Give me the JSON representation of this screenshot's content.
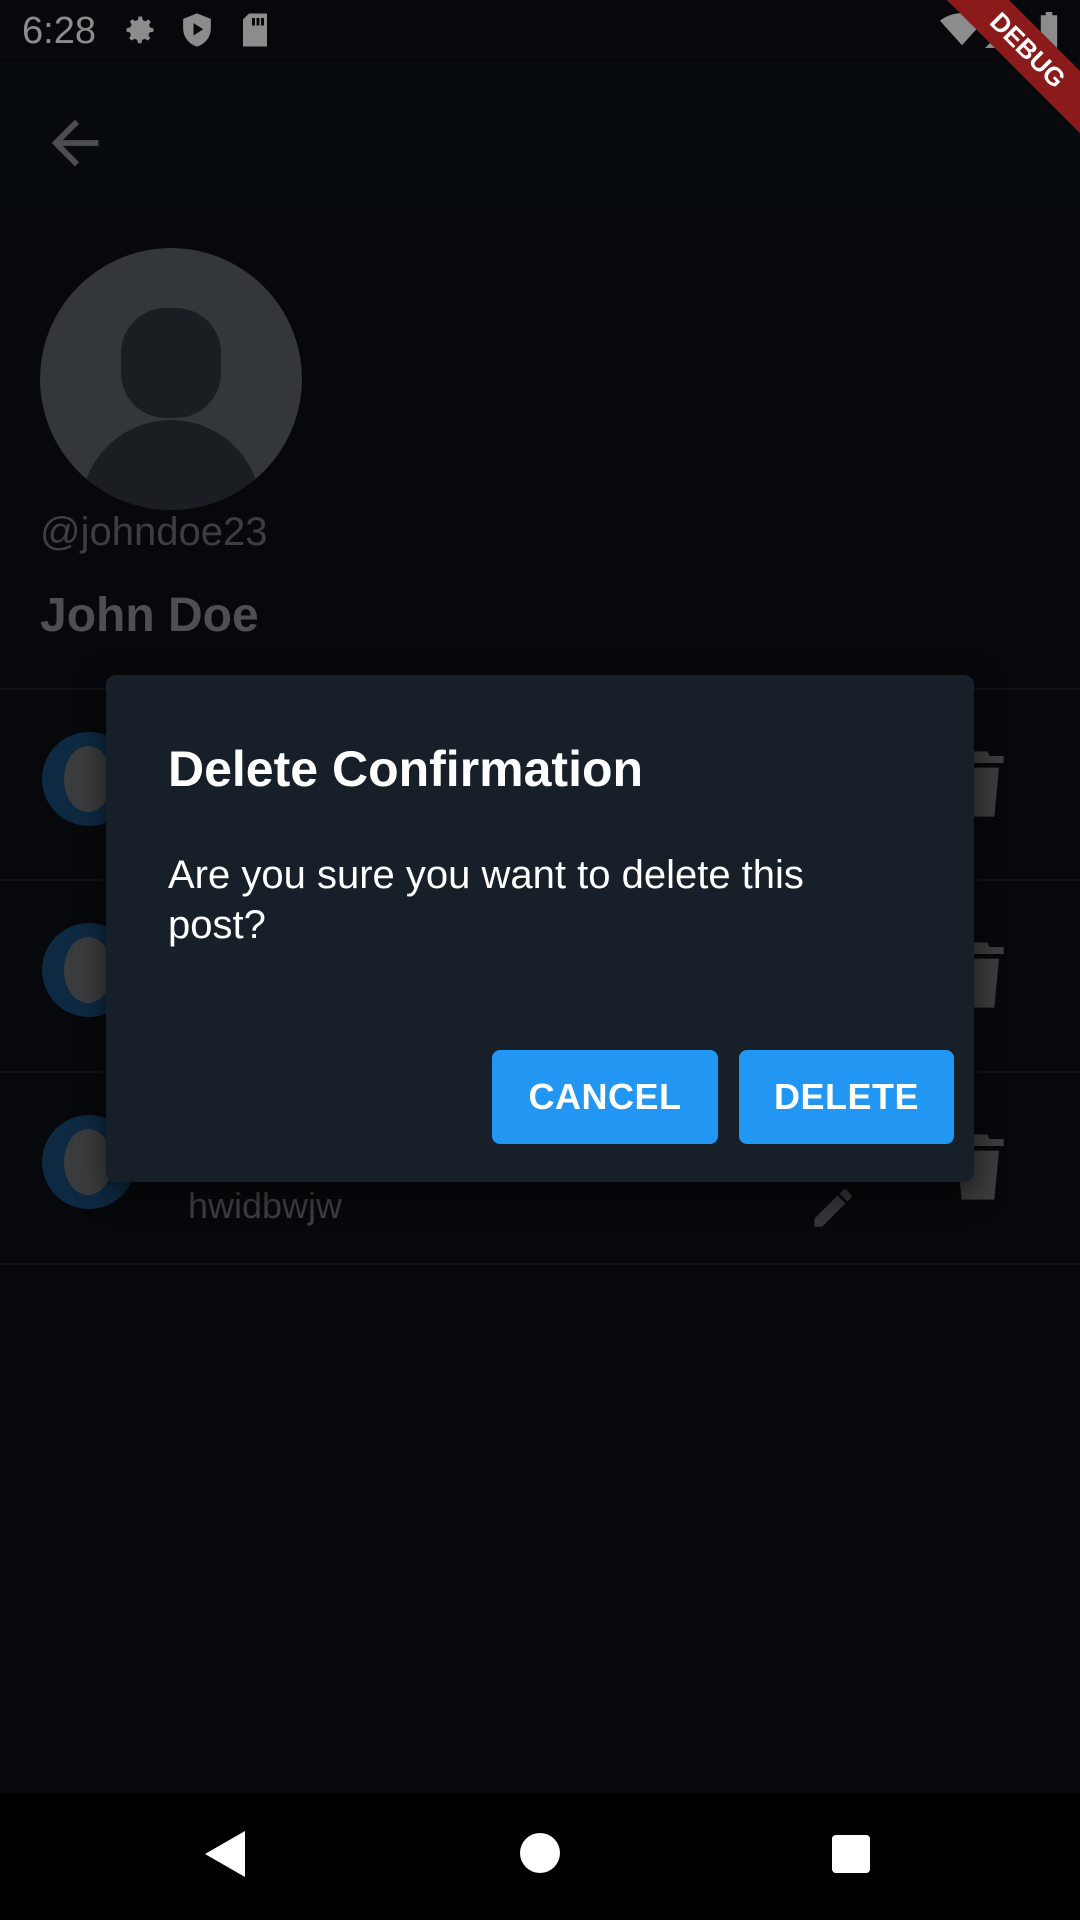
{
  "status_bar": {
    "time": "6:28",
    "icons": [
      "gear-icon",
      "shield-play-icon",
      "sd-card-icon",
      "wifi-icon",
      "signal-icon",
      "battery-icon"
    ]
  },
  "debug_banner": {
    "label": "DEBUG"
  },
  "app_bar": {
    "back_icon": "arrow-back-icon"
  },
  "profile": {
    "handle": "@johndoe23",
    "name": "John Doe"
  },
  "posts": [
    {
      "text": ""
    },
    {
      "text": ""
    },
    {
      "text": "hwidbwjw"
    }
  ],
  "dialog": {
    "title": "Delete Confirmation",
    "message": "Are you sure you want to delete this post?",
    "cancel_label": "CANCEL",
    "delete_label": "DELETE"
  },
  "nav_bar": {
    "icons": [
      "back-triangle-icon",
      "home-circle-icon",
      "recents-square-icon"
    ]
  },
  "colors": {
    "background": "#0b0f14",
    "dialog": "#172029",
    "accent": "#2196f3",
    "debug": "#8b1a1a"
  }
}
